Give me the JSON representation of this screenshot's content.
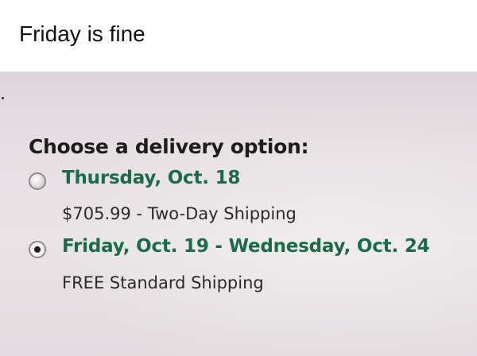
{
  "caption": "Friday is fine",
  "delivery": {
    "heading": "Choose a delivery option:",
    "options": [
      {
        "title": "Thursday, Oct. 18",
        "detail": "$705.99 - Two-Day Shipping",
        "selected": false
      },
      {
        "title": "Friday, Oct. 19 - Wednesday, Oct. 24",
        "detail": "FREE Standard Shipping",
        "selected": true
      }
    ]
  },
  "colors": {
    "option_title": "#1a6b4a",
    "heading": "#1d1d1d",
    "detail": "#2a2a2a",
    "background": "#e6dfe3"
  }
}
